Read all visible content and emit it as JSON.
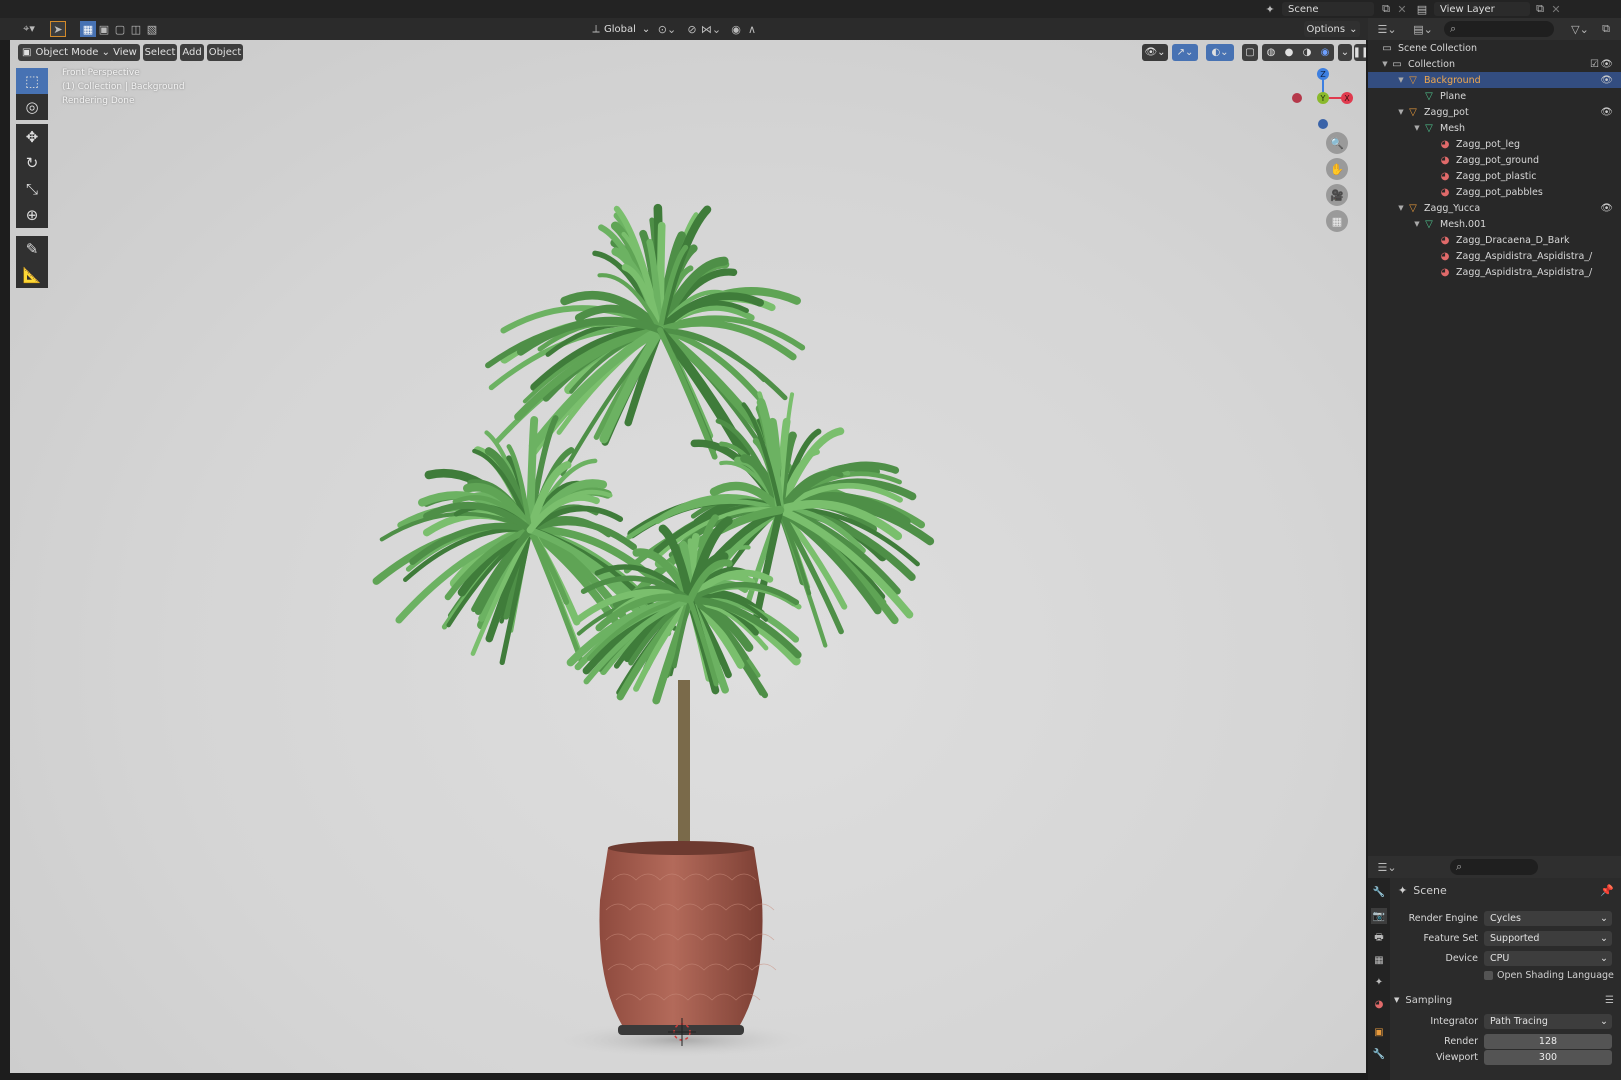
{
  "topbar": {
    "scene_name": "Scene",
    "view_layer": "View Layer"
  },
  "header": {
    "transform_orientation": "Global",
    "options_label": "Options"
  },
  "viewport": {
    "mode_label": "Object Mode",
    "menus": [
      "View",
      "Select",
      "Add",
      "Object"
    ],
    "overlay_line1": "Front Perspective",
    "overlay_line2": "(1) Collection | Background",
    "overlay_line3": "Rendering Done",
    "gizmo": {
      "z": "Z",
      "y": "Y",
      "x": "X"
    }
  },
  "outliner": {
    "rows": [
      {
        "label": "Scene Collection",
        "icon": "scene-collection-icon"
      },
      {
        "label": "Collection",
        "icon": "collection-icon"
      },
      {
        "label": "Background",
        "icon": "object-icon",
        "selected": true
      },
      {
        "label": "Plane",
        "icon": "mesh-icon"
      },
      {
        "label": "Zagg_pot",
        "icon": "object-icon"
      },
      {
        "label": "Mesh",
        "icon": "mesh-icon"
      },
      {
        "label": "Zagg_pot_leg",
        "icon": "material-icon"
      },
      {
        "label": "Zagg_pot_ground",
        "icon": "material-icon"
      },
      {
        "label": "Zagg_pot_plastic",
        "icon": "material-icon"
      },
      {
        "label": "Zagg_pot_pabbles",
        "icon": "material-icon"
      },
      {
        "label": "Zagg_Yucca",
        "icon": "object-icon"
      },
      {
        "label": "Mesh.001",
        "icon": "mesh-icon"
      },
      {
        "label": "Zagg_Dracaena_D_Bark",
        "icon": "material-icon"
      },
      {
        "label": "Zagg_Aspidistra_Aspidistra_/",
        "icon": "material-icon"
      },
      {
        "label": "Zagg_Aspidistra_Aspidistra_/",
        "icon": "material-icon"
      }
    ]
  },
  "properties": {
    "context": "Scene",
    "render_engine_label": "Render Engine",
    "render_engine": "Cycles",
    "feature_set_label": "Feature Set",
    "feature_set": "Supported",
    "device_label": "Device",
    "device": "CPU",
    "osl_label": "Open Shading Language",
    "sampling_label": "Sampling",
    "integrator_label": "Integrator",
    "integrator": "Path Tracing",
    "render_label": "Render",
    "render_samples": "128",
    "viewport_label": "Viewport",
    "viewport_samples": "300"
  },
  "colors": {
    "selection": "#334d80",
    "leaf": "#5a9e52",
    "pot": "#a15a4c",
    "gizmo_x": "#e03a4e",
    "gizmo_y": "#8ab92c",
    "gizmo_z": "#3d7fe0"
  }
}
